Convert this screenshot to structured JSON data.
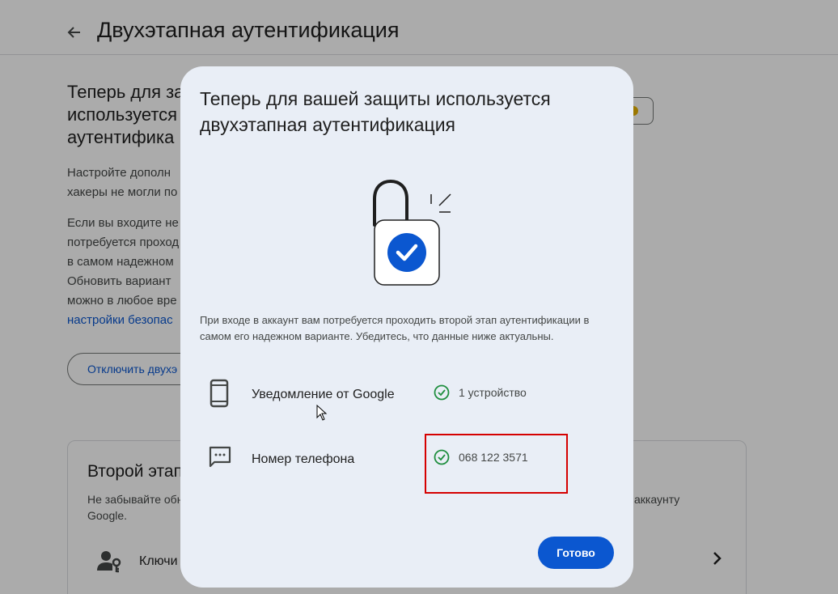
{
  "page": {
    "title": "Двухэтапная аутентификация",
    "heading_fragment": "Теперь для в… используется… аутентифика…",
    "heading_lines": [
      "Теперь для за",
      "используется",
      "аутентифика"
    ],
    "paragraph1_lines": [
      "Настройте дополн",
      "хакеры не могли по"
    ],
    "paragraph2_lines": [
      "Если вы входите не",
      "потребуется проход",
      "в самом надежном",
      "Обновить вариант",
      "можно в любое вре"
    ],
    "settings_link": "настройки безопас",
    "disable_button": "Отключить двухэ"
  },
  "second_step_card": {
    "title": "Второй этап",
    "text_left": "Не забывайте обн Google.",
    "text_left_lines": [
      "Не забывайте обн",
      "Google."
    ],
    "text_right": "к аккаунту",
    "keys_label": "Ключи"
  },
  "dialog": {
    "title": "Теперь для вашей защиты используется двухэтапная аутентификация",
    "description": "При входе в аккаунт вам потребуется проходить второй этап аутентификации в самом его надежном варианте. Убедитесь, что данные ниже актуальны.",
    "rows": [
      {
        "icon": "smartphone-icon",
        "label": "Уведомление от Google",
        "status": "1 устройство"
      },
      {
        "icon": "sms-icon",
        "label": "Номер телефона",
        "status": "068 122 3571"
      }
    ],
    "done_button": "Готово"
  },
  "colors": {
    "accent": "#0b57d0",
    "dialog_bg": "#e9eef6",
    "check_green": "#1e8e3e",
    "highlight_red": "#d50000"
  }
}
